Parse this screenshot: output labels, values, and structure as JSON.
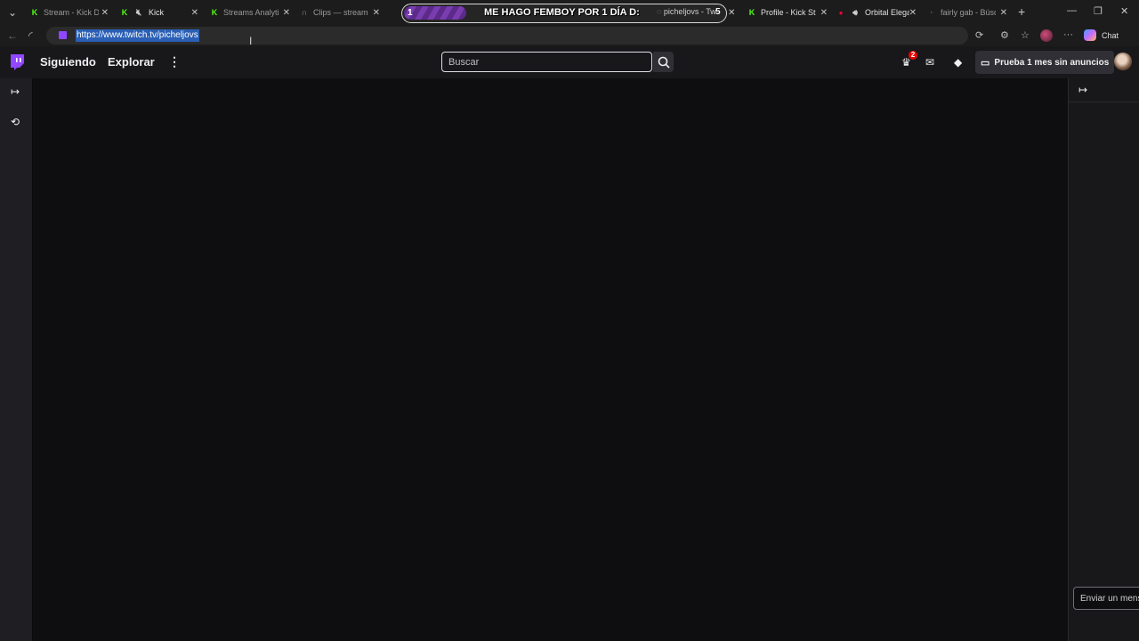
{
  "browser": {
    "tabs": [
      {
        "title": "Stream - Kick Da",
        "favicon": "kick-icon"
      },
      {
        "title": "Kick",
        "favicon": "kick-icon",
        "muted": true
      },
      {
        "title": "Streams Analytic",
        "favicon": "kick-icon"
      },
      {
        "title": "Clips — streamer",
        "favicon": "headphones-icon"
      }
    ],
    "group": {
      "pill_label": "1",
      "banner_text": "ME HAGO FEMBOY POR 1 DÍA D:",
      "tab_title": "picheljovs - Tw",
      "count": "5"
    },
    "tabs_right": [
      {
        "title": "Profile - Kick Stre",
        "favicon": "kick-icon"
      },
      {
        "title": "Orbital Elega",
        "favicon": "youtube-icon",
        "audio": true
      },
      {
        "title": "fairly gab - Búsq",
        "favicon": "search-icon"
      }
    ],
    "address": {
      "url": "https://www.twitch.tv/picheljovs"
    },
    "chat_label": "Chat"
  },
  "twitch": {
    "nav": {
      "following": "Siguiendo",
      "browse": "Explorar",
      "search_placeholder": "Buscar",
      "notifications_count": "2",
      "turbo_label": "Prueba 1 mes sin anuncios"
    },
    "chat": {
      "input_placeholder": "Enviar un mensaje"
    }
  },
  "colors": {
    "twitch_purple": "#9146ff",
    "kick_green": "#53fc18",
    "badge_red": "#eb0400"
  }
}
